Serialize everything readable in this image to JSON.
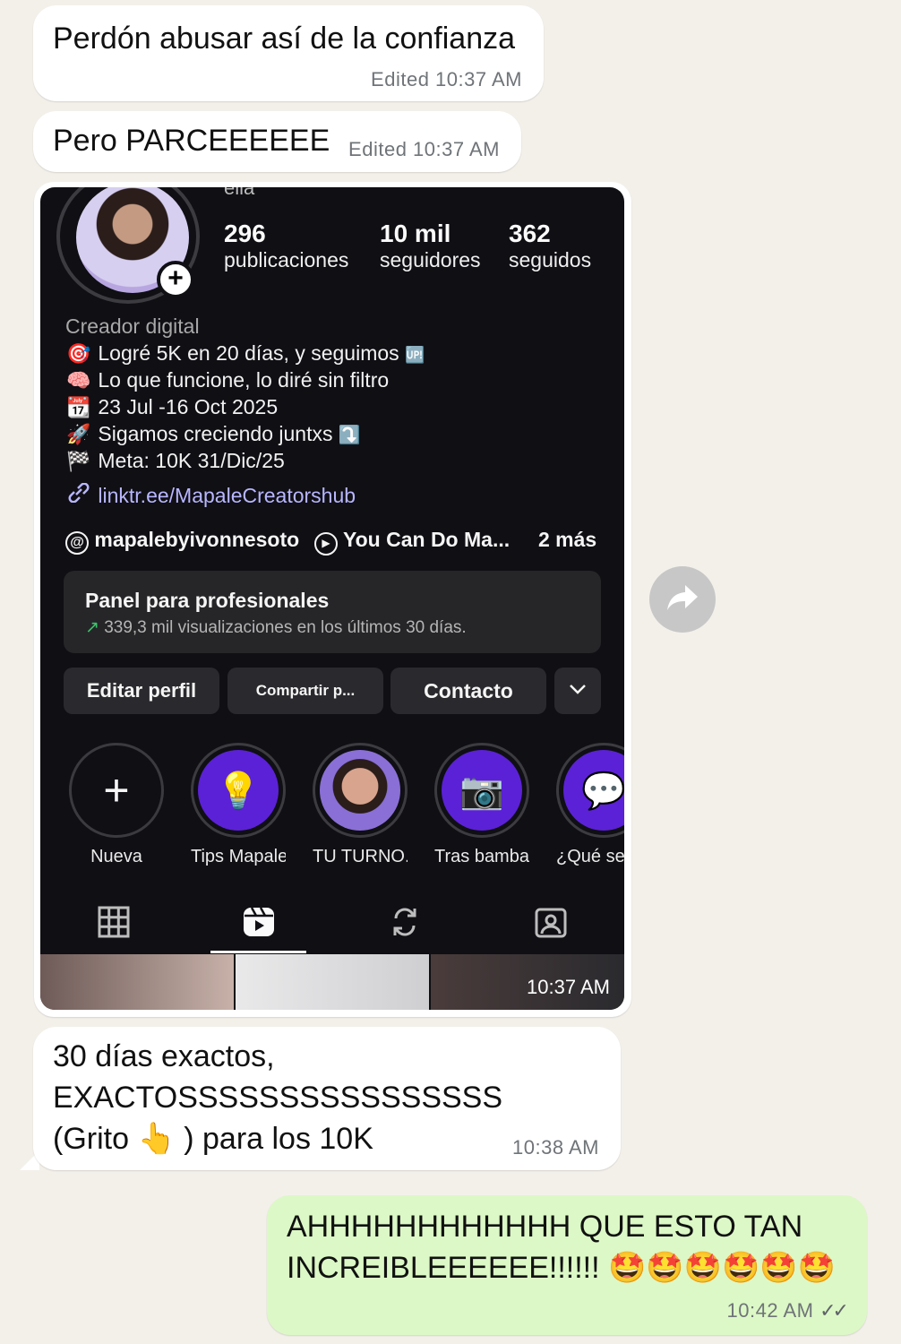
{
  "messages": {
    "m1": {
      "text": "Perdón abusar así de la confianza",
      "meta": "Edited  10:37 AM"
    },
    "m2": {
      "text": "Pero PARCEEEEEE",
      "meta": "Edited  10:37 AM"
    },
    "m3": {
      "meta": "10:37 AM"
    },
    "m4": {
      "text": "30 días exactos,\nEXACTOSSSSSSSSSSSSSSSS\n(Grito 👆 ) para los 10K",
      "meta": "10:38 AM"
    },
    "m5": {
      "text": "AHHHHHHHHHHHH QUE ESTO TAN\nINCREIBLEEEEEE!!!!!! 🤩🤩🤩🤩🤩🤩",
      "meta": "10:42 AM",
      "status": "✓✓"
    }
  },
  "profile": {
    "name_cut": "ella",
    "stats": [
      {
        "num": "296",
        "label": "publicaciones"
      },
      {
        "num": "10 mil",
        "label": "seguidores"
      },
      {
        "num": "362",
        "label": "seguidos"
      }
    ],
    "category": "Creador digital",
    "bio": [
      {
        "emoji": "🎯",
        "text": "Logré 5K en 20 días, y seguimos",
        "suffix": "🆙"
      },
      {
        "emoji": "🧠",
        "text": "Lo que funcione, lo diré sin filtro",
        "suffix": ""
      },
      {
        "emoji": "📆",
        "text": "23 Jul -16 Oct 2025",
        "suffix": ""
      },
      {
        "emoji": "🚀",
        "text": "Sigamos creciendo juntxs",
        "suffix": "⤵️"
      },
      {
        "emoji": "🏁",
        "text": "Meta: 10K 31/Dic/25",
        "suffix": ""
      }
    ],
    "link": "linktr.ee/MapaleCreatorshub",
    "threads_handle": "mapalebyivonnesoto",
    "channel": "You Can Do Ma...",
    "more": "2 más",
    "panel_title": "Panel para profesionales",
    "panel_sub": "339,3 mil visualizaciones en los últimos 30 días.",
    "buttons": {
      "edit": "Editar perfil",
      "share": "Compartir p...",
      "contact": "Contacto"
    },
    "highlights": [
      {
        "label": "Nueva",
        "icon": "plus"
      },
      {
        "label": "Tips Mapale",
        "icon": "💡"
      },
      {
        "label": "TU TURNO...",
        "icon": "face"
      },
      {
        "label": "Tras bamba...",
        "icon": "📷"
      },
      {
        "label": "¿Qué se c",
        "icon": "💬"
      }
    ]
  },
  "colors": {
    "chat_bg": "#f3f0ea",
    "incoming": "#ffffff",
    "outgoing": "#dcf8c6",
    "ig_bg": "#0f0f14",
    "link": "#b8b6ff",
    "highlight": "#5b21d6"
  }
}
